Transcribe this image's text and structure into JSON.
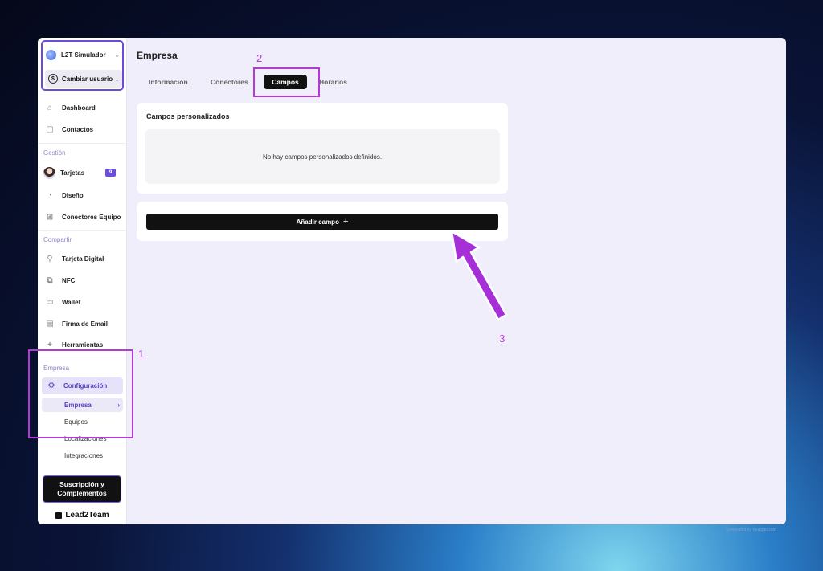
{
  "sidebar": {
    "account_name": "L2T Simulador",
    "switch_user_label": "Cambiar usuario",
    "items_top": [
      {
        "label": "Dashboard",
        "icon": "home-icon"
      },
      {
        "label": "Contactos",
        "icon": "contacts-icon"
      }
    ],
    "section_gestion": "Gestión",
    "items_gestion": [
      {
        "label": "Tarjetas",
        "badge": "9"
      },
      {
        "label": "Diseño",
        "icon": "palette-icon"
      },
      {
        "label": "Conectores Equipo",
        "icon": "grid-icon"
      }
    ],
    "section_compartir": "Compartir",
    "items_compartir": [
      {
        "label": "Tarjeta Digital",
        "icon": "qr-icon"
      },
      {
        "label": "NFC",
        "icon": "nfc-icon"
      },
      {
        "label": "Wallet",
        "icon": "wallet-icon"
      },
      {
        "label": "Firma de Email",
        "icon": "signature-icon"
      },
      {
        "label": "Herramientas",
        "icon": "plus-icon"
      }
    ],
    "section_empresa": "Empresa",
    "config_label": "Configuración",
    "sub_items": [
      "Empresa",
      "Equipos",
      "Localizaciones",
      "Integraciones"
    ],
    "cta_label": "Suscripción y\nComplementos",
    "brand": "Lead2Team"
  },
  "main": {
    "title": "Empresa",
    "tabs": [
      "Información",
      "Conectores",
      "Campos",
      "Horarios"
    ],
    "active_tab": "Campos",
    "custom_fields_title": "Campos personalizados",
    "empty_text": "No hay campos personalizados definidos.",
    "add_field_label": "Añadir campo"
  },
  "annotations": [
    "1",
    "2",
    "3"
  ],
  "watermark": "Screenshot by Xnapper.com",
  "colors": {
    "accent": "#6b4fd8",
    "annotation": "#b23bd6",
    "button": "#111111"
  }
}
